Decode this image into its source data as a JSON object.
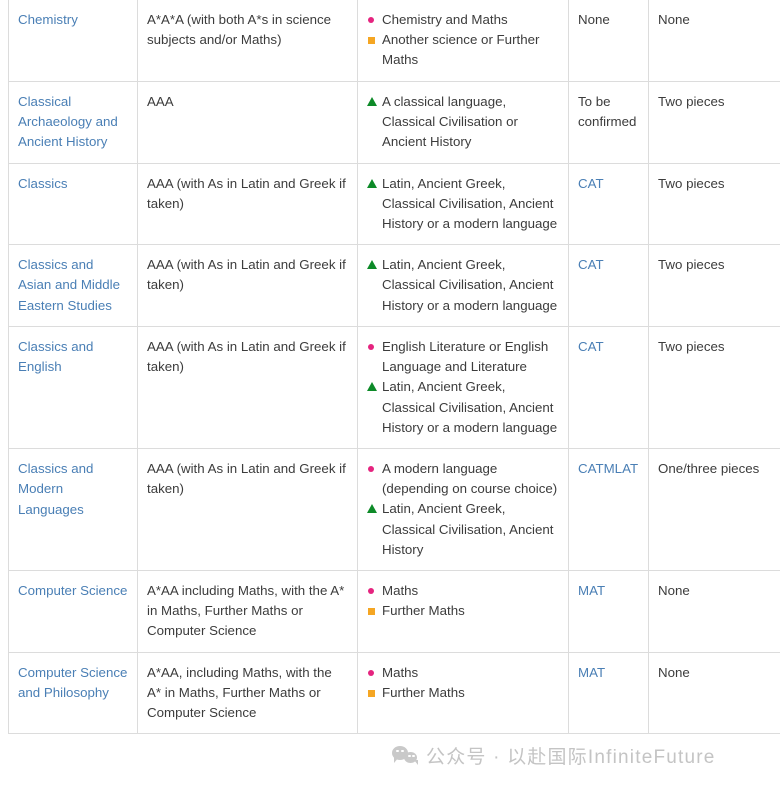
{
  "page": {
    "kind": "university-admissions-requirements-table"
  },
  "watermark": {
    "icon": "wechat-logo-icon",
    "text": "公众号 · 以赴国际InfiniteFuture"
  },
  "colors": {
    "link": "#4a7fb5",
    "marker_circle": "#e5247f",
    "marker_square": "#f5a623",
    "marker_triangle": "#0d8a28",
    "border": "#dcdcdc",
    "body_text": "#3c3c3c"
  },
  "table": {
    "rows": [
      {
        "course": "Chemistry",
        "grades": "A*A*A (with both A*s in science subjects and/or Maths)",
        "subjects": [
          {
            "marker": "circle",
            "text": "Chemistry and Maths"
          },
          {
            "marker": "square",
            "text": "Another science or Further Maths"
          }
        ],
        "test": {
          "type": "text",
          "value": "None"
        },
        "written_work": "None"
      },
      {
        "course": "Classical Archaeology and Ancient History",
        "grades": "AAA",
        "subjects": [
          {
            "marker": "triangle",
            "text": "A classical language, Classical Civilisation or Ancient History"
          }
        ],
        "test": {
          "type": "text",
          "value": "To be confirmed"
        },
        "written_work": "Two pieces"
      },
      {
        "course": "Classics",
        "grades": "AAA (with As in Latin and Greek if taken)",
        "subjects": [
          {
            "marker": "triangle",
            "text": "Latin, Ancient Greek, Classical Civilisation, Ancient History or a modern language"
          }
        ],
        "test": {
          "type": "links",
          "value": [
            "CAT"
          ]
        },
        "written_work": "Two pieces"
      },
      {
        "course": "Classics and Asian and Middle Eastern Studies",
        "grades": " AAA (with As in Latin and Greek if taken)",
        "subjects": [
          {
            "marker": "triangle",
            "text": "Latin, Ancient Greek, Classical Civilisation, Ancient History or a modern language"
          }
        ],
        "test": {
          "type": "links",
          "value": [
            "CAT"
          ]
        },
        "written_work": " Two pieces"
      },
      {
        "course": "Classics and English",
        "grades": "AAA (with As in Latin and Greek if taken)",
        "subjects": [
          {
            "marker": "circle",
            "text": "English Literature or English Language and Literature"
          },
          {
            "marker": "triangle",
            "text": "Latin, Ancient Greek, Classical Civilisation, Ancient History or a modern language"
          }
        ],
        "test": {
          "type": "links",
          "value": [
            "CAT"
          ]
        },
        "written_work": "Two pieces"
      },
      {
        "course": "Classics and Modern Languages",
        "grades": "AAA (with As in Latin and Greek if taken)",
        "subjects": [
          {
            "marker": "circle",
            "text": "A modern language (depending on course choice)"
          },
          {
            "marker": "triangle",
            "text": "Latin, Ancient Greek, Classical Civilisation, Ancient History"
          }
        ],
        "test": {
          "type": "links",
          "value": [
            "CAT",
            "MLAT"
          ]
        },
        "written_work": "One/three pieces"
      },
      {
        "course": "Computer Science",
        "grades": "A*AA including Maths, with the A* in Maths, Further Maths or Computer Science",
        "subjects": [
          {
            "marker": "circle",
            "text": "Maths"
          },
          {
            "marker": "square",
            "text": "Further Maths"
          }
        ],
        "test": {
          "type": "links",
          "value": [
            "MAT"
          ]
        },
        "written_work": "None"
      },
      {
        "course": "Computer Science and Philosophy",
        "grades": "A*AA, including Maths, with the A* in Maths, Further Maths or Computer Science",
        "subjects": [
          {
            "marker": "circle",
            "text": "Maths"
          },
          {
            "marker": "square",
            "text": "Further Maths"
          }
        ],
        "test": {
          "type": "links",
          "value": [
            "MAT"
          ]
        },
        "written_work": "None"
      }
    ]
  }
}
